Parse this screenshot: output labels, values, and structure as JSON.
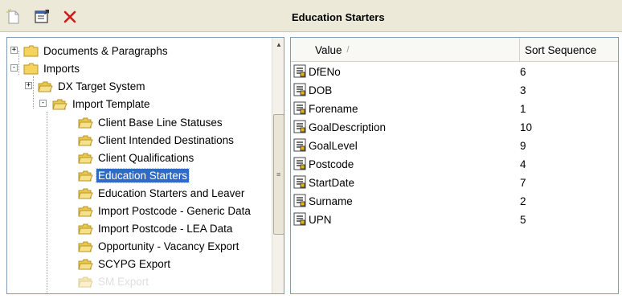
{
  "toolbar": {
    "title": "Education Starters",
    "buttons": [
      {
        "icon": "new-item-icon"
      },
      {
        "icon": "properties-icon"
      },
      {
        "icon": "delete-icon"
      }
    ]
  },
  "tree": {
    "items": [
      {
        "label": "Documents & Paragraphs",
        "icon": "closed-folder-icon",
        "expander": "+"
      },
      {
        "label": "Imports",
        "icon": "closed-folder-icon",
        "expander": "-"
      },
      {
        "label": "DX Target System",
        "icon": "open-folder-icon",
        "expander": "+"
      },
      {
        "label": "Import Template",
        "icon": "open-folder-icon",
        "expander": "-"
      },
      {
        "label": "Client Base Line Statuses",
        "icon": "open-folder-icon"
      },
      {
        "label": "Client Intended Destinations",
        "icon": "open-folder-icon"
      },
      {
        "label": "Client Qualifications",
        "icon": "open-folder-icon"
      },
      {
        "label": "Education Starters",
        "icon": "open-folder-icon",
        "selected": true
      },
      {
        "label": "Education Starters and Leaver",
        "icon": "open-folder-icon"
      },
      {
        "label": "Import Postcode - Generic Data",
        "icon": "open-folder-icon"
      },
      {
        "label": "Import Postcode - LEA Data",
        "icon": "open-folder-icon"
      },
      {
        "label": "Opportunity - Vacancy Export",
        "icon": "open-folder-icon"
      },
      {
        "label": "SCYPG Export",
        "icon": "open-folder-icon"
      },
      {
        "label": "SM Export",
        "icon": "open-folder-icon",
        "faded": true
      }
    ]
  },
  "grid": {
    "columns": {
      "value": "Value",
      "sort": "Sort Sequence",
      "sort_indicator": "/"
    },
    "rows": [
      {
        "value": "DfENo",
        "sort": "6"
      },
      {
        "value": "DOB",
        "sort": "3"
      },
      {
        "value": "Forename",
        "sort": "1"
      },
      {
        "value": "GoalDescription",
        "sort": "10"
      },
      {
        "value": "GoalLevel",
        "sort": "9"
      },
      {
        "value": "Postcode",
        "sort": "4"
      },
      {
        "value": "StartDate",
        "sort": "7"
      },
      {
        "value": "Surname",
        "sort": "2"
      },
      {
        "value": "UPN",
        "sort": "5"
      }
    ]
  },
  "colors": {
    "selection": "#316ac5",
    "folder": "#f4d35e",
    "delete": "#cc1a1a",
    "border": "#7f9db9"
  }
}
